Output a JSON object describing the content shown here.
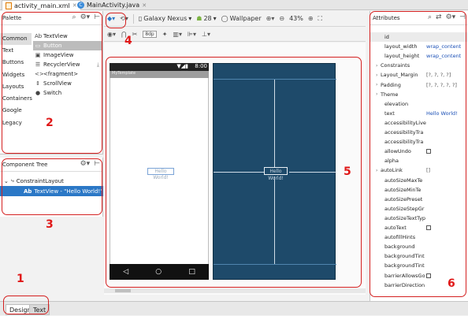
{
  "file_tabs": [
    {
      "label": "activity_main.xml",
      "active": true
    },
    {
      "label": "MainActivity.java",
      "active": false
    }
  ],
  "palette": {
    "title": "Palette",
    "categories": [
      "Common",
      "Text",
      "Buttons",
      "Widgets",
      "Layouts",
      "Containers",
      "Google",
      "Legacy"
    ],
    "selected_category": "Common",
    "widgets": [
      {
        "label": "TextView",
        "icon": "Ab"
      },
      {
        "label": "Button",
        "icon": "▭",
        "selected": true
      },
      {
        "label": "ImageView",
        "icon": "▣"
      },
      {
        "label": "RecyclerView",
        "icon": "☰"
      },
      {
        "label": "<fragment>",
        "icon": "<>"
      },
      {
        "label": "ScrollView",
        "icon": "⇕"
      },
      {
        "label": "Switch",
        "icon": "●"
      }
    ]
  },
  "component_tree": {
    "title": "Component Tree",
    "items": [
      {
        "label": "ConstraintLayout",
        "icon": "⤷"
      },
      {
        "label": "TextView - \"Hello World!\"",
        "icon": "Ab",
        "selected": true
      }
    ]
  },
  "toolbar_top": {
    "device": "Galaxy Nexus",
    "api": "28",
    "theme": "Wallpaper",
    "zoom": "43%"
  },
  "toolbar_second": {
    "margin": "8dp"
  },
  "design_preview": {
    "status_time": "8:00",
    "app_title": "MyTemplate",
    "hello_text": "Hello World!"
  },
  "attributes": {
    "title": "Attributes",
    "rows": [
      {
        "name": "id",
        "value": "",
        "kind": "id"
      },
      {
        "name": "layout_width",
        "value": "wrap_content"
      },
      {
        "name": "layout_height",
        "value": "wrap_content"
      },
      {
        "name": "Constraints",
        "value": "",
        "kind": "expander"
      },
      {
        "name": "Layout_Margin",
        "value": "[?, ?, ?, ?]",
        "kind": "expander"
      },
      {
        "name": "Padding",
        "value": "[?, ?, ?, ?, ?]",
        "kind": "expander"
      },
      {
        "name": "Theme",
        "value": "",
        "kind": "expander"
      },
      {
        "name": "elevation",
        "value": ""
      },
      {
        "name": "text",
        "value": "Hello World!"
      },
      {
        "name": "accessibilityLive",
        "value": ""
      },
      {
        "name": "accessibilityTra",
        "value": ""
      },
      {
        "name": "accessibilityTra",
        "value": ""
      },
      {
        "name": "allowUndo",
        "value": "",
        "kind": "check"
      },
      {
        "name": "alpha",
        "value": ""
      },
      {
        "name": "autoLink",
        "value": "[]",
        "kind": "expander"
      },
      {
        "name": "autoSizeMaxTe",
        "value": ""
      },
      {
        "name": "autoSizeMinTe",
        "value": ""
      },
      {
        "name": "autoSizePreset",
        "value": ""
      },
      {
        "name": "autoSizeStepGr",
        "value": ""
      },
      {
        "name": "autoSizeTextTyp",
        "value": ""
      },
      {
        "name": "autoText",
        "value": "",
        "kind": "check"
      },
      {
        "name": "autofillHints",
        "value": ""
      },
      {
        "name": "background",
        "value": ""
      },
      {
        "name": "backgroundTint",
        "value": ""
      },
      {
        "name": "backgroundTint",
        "value": ""
      },
      {
        "name": "barrierAllowsGo",
        "value": "",
        "kind": "check"
      },
      {
        "name": "barrierDirection",
        "value": ""
      }
    ]
  },
  "bottom_tabs": [
    {
      "label": "Design",
      "active": true
    },
    {
      "label": "Text",
      "active": false
    }
  ],
  "annotations": [
    "1",
    "2",
    "3",
    "4",
    "5",
    "6"
  ],
  "colors": {
    "annotation": "#d42020",
    "selection_blue": "#2b78c6",
    "blueprint": "#1e4a6a",
    "link_value": "#1a4fb6"
  }
}
